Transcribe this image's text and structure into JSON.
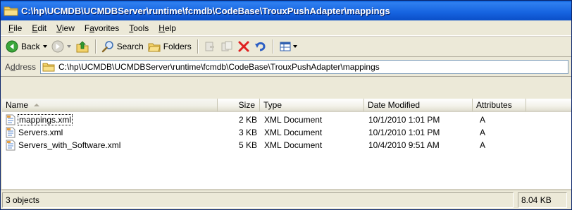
{
  "window": {
    "title": "C:\\hp\\UCMDB\\UCMDBServer\\runtime\\fcmdb\\CodeBase\\TrouxPushAdapter\\mappings"
  },
  "menu": [
    {
      "underline": "F",
      "rest": "ile"
    },
    {
      "underline": "E",
      "rest": "dit"
    },
    {
      "underline": "V",
      "rest": "iew"
    },
    {
      "pre": "F",
      "underline": "a",
      "rest": "vorites"
    },
    {
      "underline": "T",
      "rest": "ools"
    },
    {
      "underline": "H",
      "rest": "elp"
    }
  ],
  "toolbar": {
    "back_label": "Back",
    "search_label": "Search",
    "folders_label": "Folders"
  },
  "address": {
    "label_pre": "A",
    "label_underline": "d",
    "label_rest": "dress",
    "value": "C:\\hp\\UCMDB\\UCMDBServer\\runtime\\fcmdb\\CodeBase\\TrouxPushAdapter\\mappings"
  },
  "columns": {
    "name": "Name",
    "size": "Size",
    "type": "Type",
    "date": "Date Modified",
    "attributes": "Attributes"
  },
  "files": [
    {
      "name": "mappings.xml",
      "size": "2 KB",
      "type": "XML Document",
      "date": "10/1/2010 1:01 PM",
      "attributes": "A"
    },
    {
      "name": "Servers.xml",
      "size": "3 KB",
      "type": "XML Document",
      "date": "10/1/2010 1:01 PM",
      "attributes": "A"
    },
    {
      "name": "Servers_with_Software.xml",
      "size": "5 KB",
      "type": "XML Document",
      "date": "10/4/2010 9:51 AM",
      "attributes": "A"
    }
  ],
  "status": {
    "objects": "3 objects",
    "size": "8.04 KB"
  },
  "colors": {
    "titlebar": "#1663e0",
    "chrome": "#ece9d8",
    "delete_red": "#e02020"
  }
}
